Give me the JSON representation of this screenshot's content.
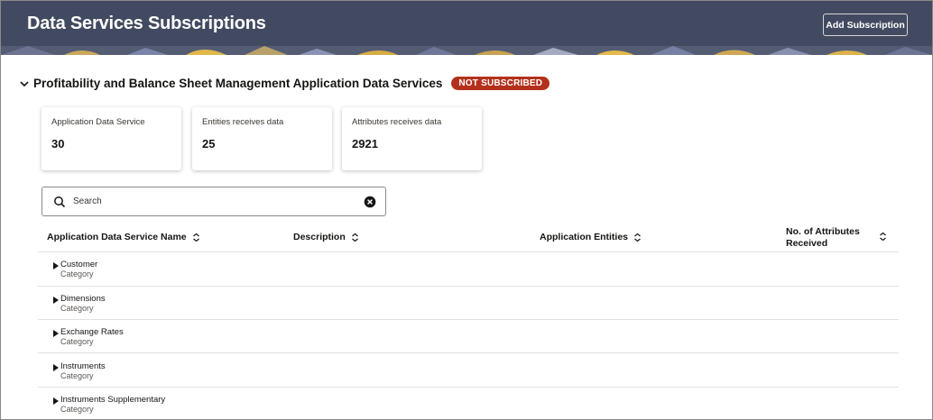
{
  "header": {
    "title": "Data Services Subscriptions",
    "add_button_label": "Add Subscription",
    "bg_color": "#424a61"
  },
  "section": {
    "title": "Profitability and Balance Sheet Management Application Data Services",
    "status_badge": "NOT SUBSCRIBED",
    "badge_color": "#b3311c",
    "expand_icon": "chevron-down-icon"
  },
  "cards": [
    {
      "label": "Application Data Service",
      "value": "30"
    },
    {
      "label": "Entities receives data",
      "value": "25"
    },
    {
      "label": "Attributes receives data",
      "value": "2921"
    }
  ],
  "search": {
    "placeholder": "Search",
    "icon": "search-icon",
    "clear_icon": "clear-icon"
  },
  "table": {
    "columns": [
      {
        "label": "Application Data Service Name"
      },
      {
        "label": "Description"
      },
      {
        "label": "Application Entities"
      },
      {
        "label": "No. of Attributes Received"
      }
    ],
    "rows": [
      {
        "name": "Customer",
        "type": "Category"
      },
      {
        "name": "Dimensions",
        "type": "Category"
      },
      {
        "name": "Exchange Rates",
        "type": "Category"
      },
      {
        "name": "Instruments",
        "type": "Category"
      },
      {
        "name": "Instruments Supplementary",
        "type": "Category"
      }
    ]
  }
}
